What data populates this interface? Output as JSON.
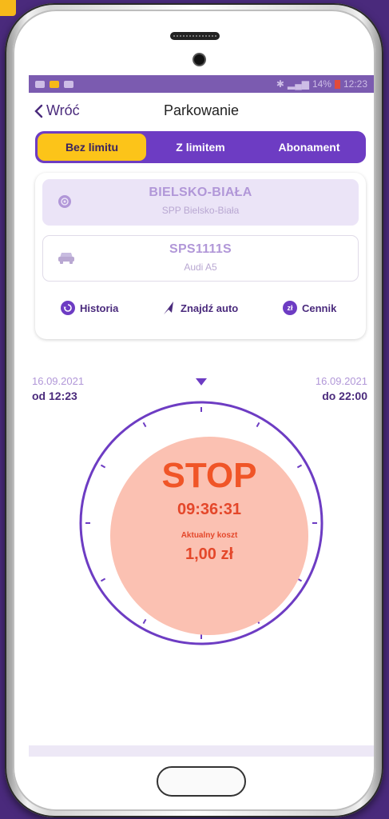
{
  "status_bar": {
    "right_text": "14%",
    "time": "12:23"
  },
  "header": {
    "back_label": "Wróć",
    "title": "Parkowanie"
  },
  "tabs": [
    {
      "label": "Bez limitu",
      "active": true
    },
    {
      "label": "Z limitem",
      "active": false
    },
    {
      "label": "Abonament",
      "active": false
    }
  ],
  "zone": {
    "city": "BIELSKO-BIAŁA",
    "zone_name": "SPP Bielsko-Biała",
    "icon": "location-target-icon"
  },
  "vehicle": {
    "plate": "SPS1111S",
    "model": "Audi A5",
    "icon": "car-icon"
  },
  "actions": {
    "history": "Historia",
    "find_car": "Znajdź auto",
    "pricing": "Cennik",
    "pricing_badge": "zł"
  },
  "session": {
    "start_date": "16.09.2021",
    "start_time": "od 12:23",
    "end_date": "16.09.2021",
    "end_time": "do 22:00",
    "stop_label": "STOP",
    "elapsed": "09:36:31",
    "cost_label": "Aktualny koszt",
    "cost_value": "1,00 zł"
  },
  "colors": {
    "primary": "#6d3cc3",
    "accent": "#fcc419",
    "stop_bg": "#fbc1b2",
    "stop_text": "#f05527"
  }
}
